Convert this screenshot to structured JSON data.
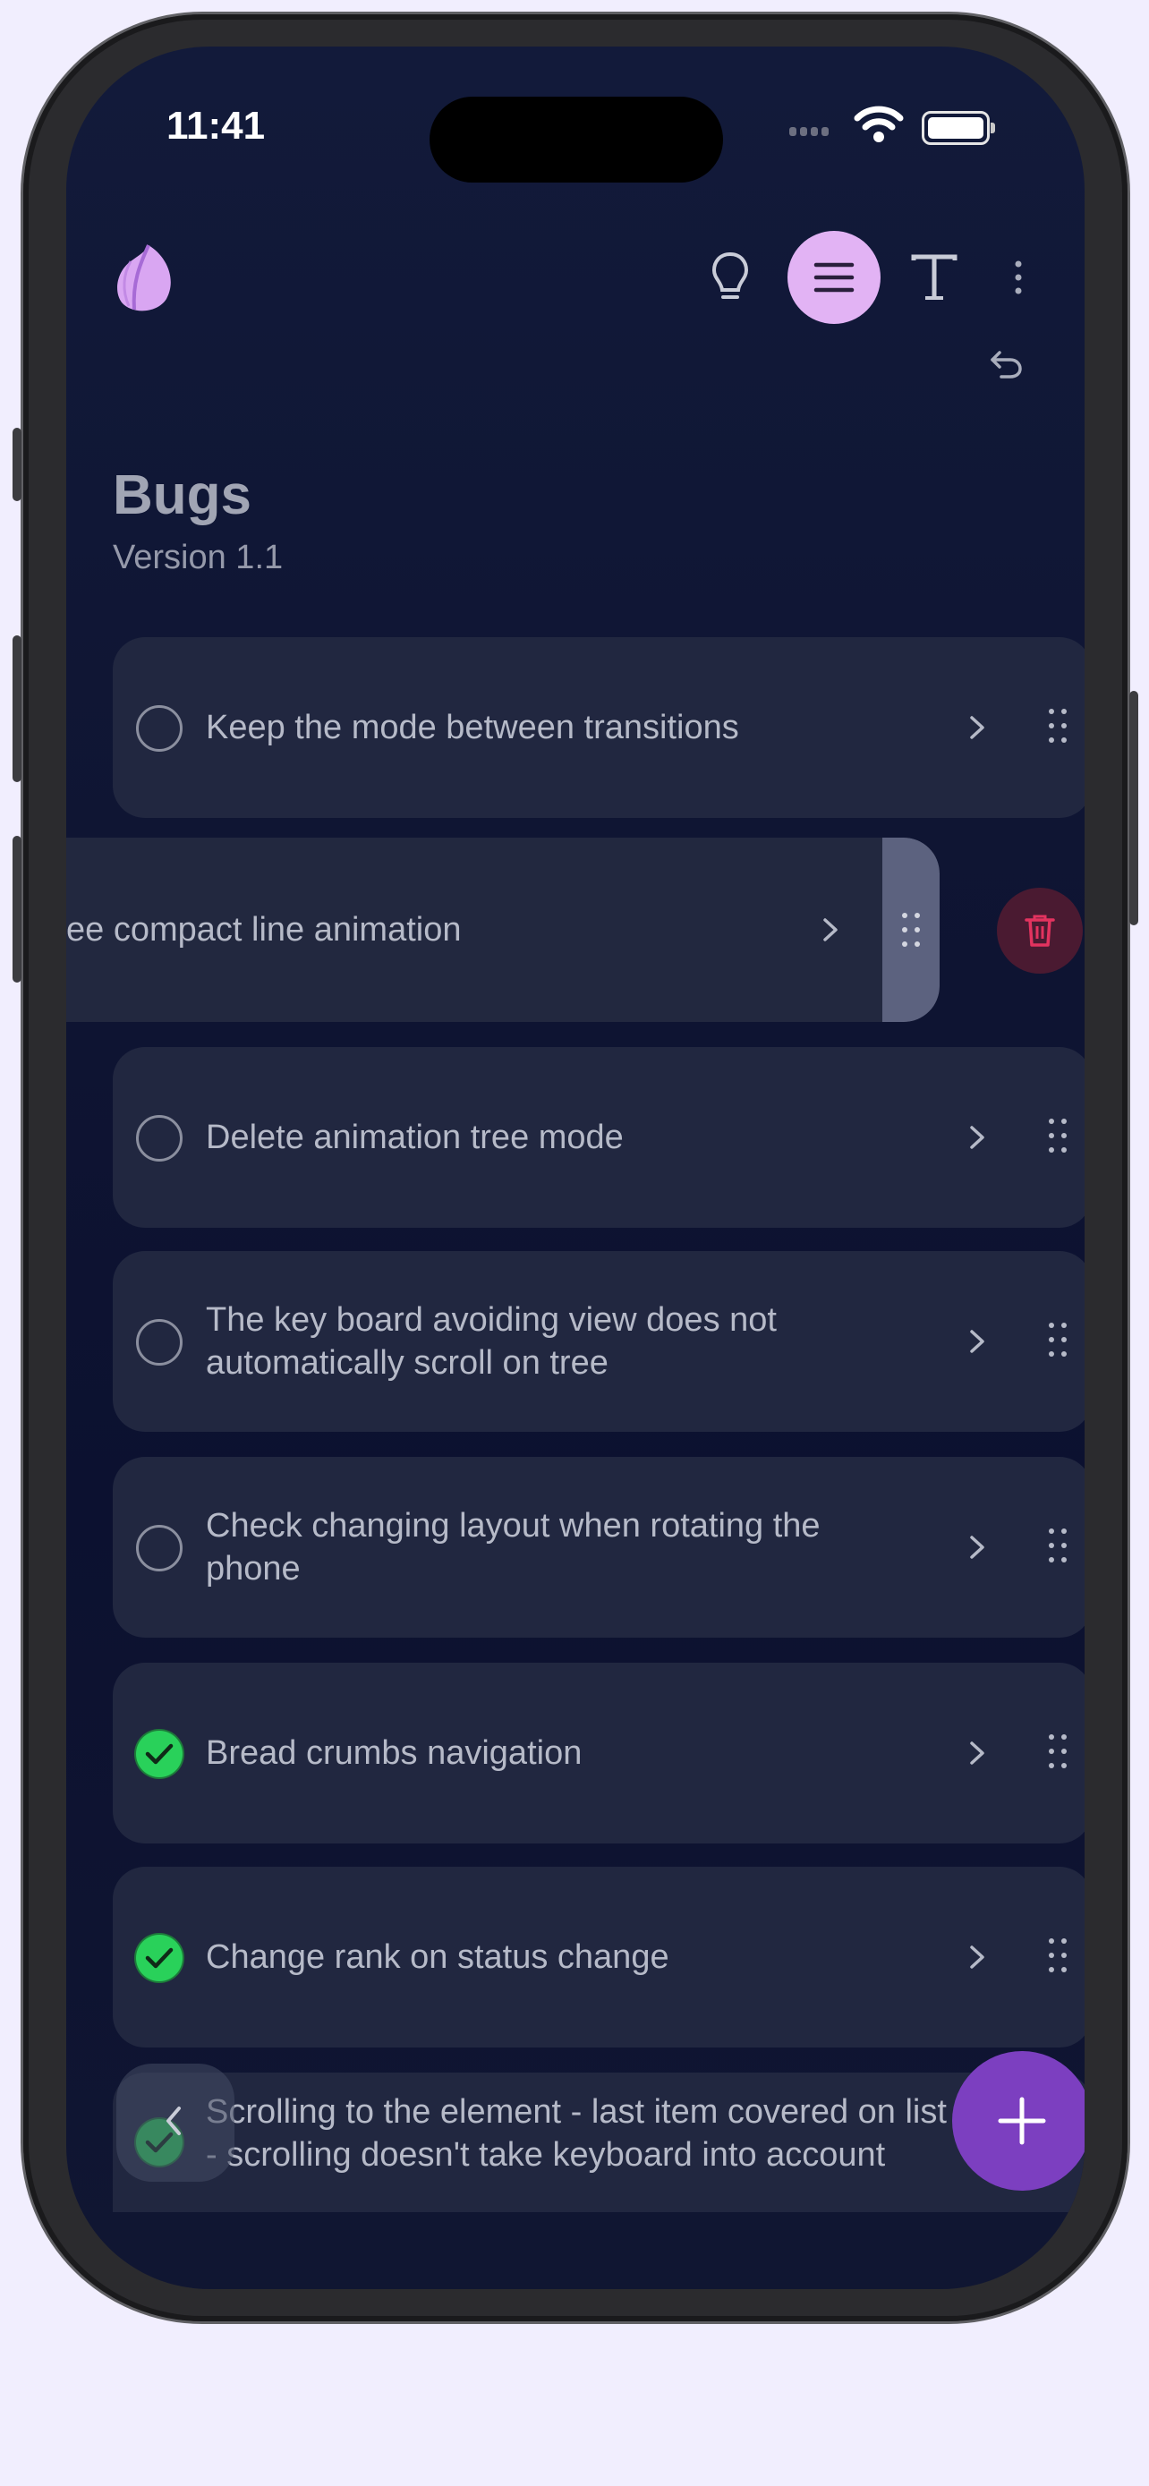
{
  "status_bar": {
    "time": "11:41"
  },
  "page": {
    "title": "Bugs",
    "subtitle": "Version 1.1"
  },
  "tasks": [
    {
      "text": "Keep the mode between transitions",
      "done": false
    },
    {
      "text": "ee compact line animation",
      "done": false,
      "swiped": true
    },
    {
      "text": "Delete animation tree mode",
      "done": false
    },
    {
      "text": "The key board avoiding view does not automatically scroll on tree",
      "done": false
    },
    {
      "text": "Check changing layout when rotating the phone",
      "done": false
    },
    {
      "text": "Bread crumbs navigation",
      "done": true
    },
    {
      "text": "Change rank on status change",
      "done": true
    },
    {
      "text": "Scrolling to the element - last item covered on list - scrolling doesn't take keyboard into account",
      "done": true
    }
  ],
  "icons": {
    "logo": "leaf-logo-icon",
    "toolbar": [
      "lightbulb-icon",
      "list-icon",
      "text-format-icon",
      "more-vertical-icon",
      "undo-icon"
    ],
    "row": [
      "circle-checkbox-icon",
      "check-circle-icon",
      "chevron-right-icon",
      "drag-handle-icon"
    ],
    "delete": "trash-icon",
    "fab": "plus-icon",
    "back": "chevron-left-icon"
  },
  "colors": {
    "accent": "#e2b3f4",
    "fab": "#7c3fc0",
    "done": "#29d15a",
    "delete": "#e2335f",
    "card": "#212740"
  }
}
